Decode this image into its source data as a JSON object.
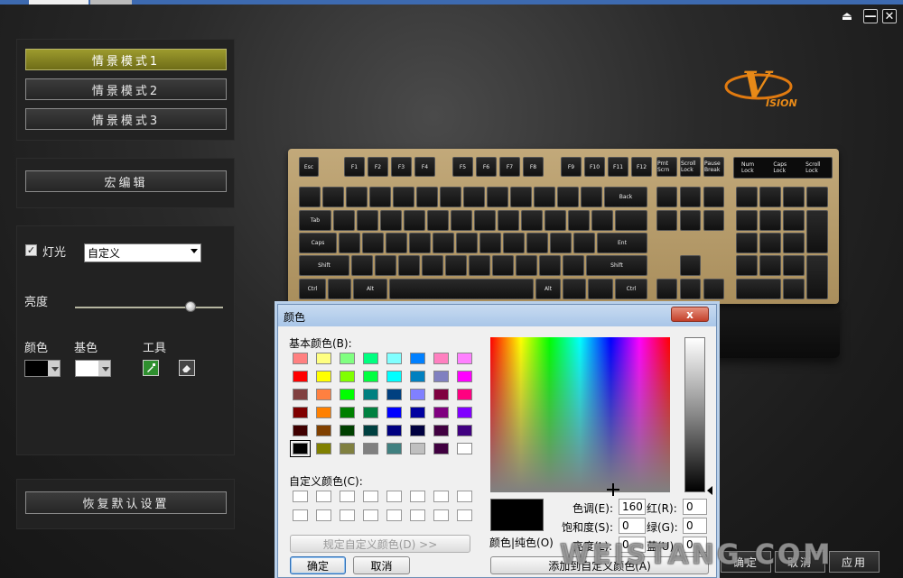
{
  "window": {
    "controls": {
      "eject": "⏏",
      "minimize": "—",
      "close": "✕"
    }
  },
  "left": {
    "modes": [
      {
        "label": "情景模式1",
        "active": true
      },
      {
        "label": "情景模式2",
        "active": false
      },
      {
        "label": "情景模式3",
        "active": false
      }
    ],
    "macro_button": "宏编辑",
    "light": {
      "checkbox_label": "灯光",
      "checked": true,
      "mode_selected": "自定义",
      "brightness_label": "亮度",
      "brightness_level": 0.78,
      "color_label": "颜色",
      "base_color_label": "基色",
      "tool_label": "工具",
      "color_value": "#000000",
      "base_color_value": "#ffffff"
    },
    "restore_button": "恢复默认设置"
  },
  "logo": {
    "text": "ISION",
    "letter": "V",
    "color": "#e07a10"
  },
  "keyboard": {
    "fn_row": [
      "Esc",
      "F1",
      "F2",
      "F3",
      "F4",
      "F5",
      "F6",
      "F7",
      "F8",
      "F9",
      "F10",
      "F11",
      "F12",
      "Prnt Scrn",
      "Scroll Lock",
      "Pause Break"
    ],
    "indicators": [
      "Num Lock",
      "Caps Lock",
      "Scroll Lock"
    ]
  },
  "dialog": {
    "title": "颜色",
    "close": "x",
    "basic_colors_label": "基本颜色(B):",
    "basic_colors": [
      [
        "#ff8080",
        "#ffff80",
        "#80ff80",
        "#00ff80",
        "#80ffff",
        "#0080ff",
        "#ff80c0",
        "#ff80ff"
      ],
      [
        "#ff0000",
        "#ffff00",
        "#80ff00",
        "#00ff40",
        "#00ffff",
        "#0080c0",
        "#8080c0",
        "#ff00ff"
      ],
      [
        "#804040",
        "#ff8040",
        "#00ff00",
        "#008080",
        "#004080",
        "#8080ff",
        "#800040",
        "#ff0080"
      ],
      [
        "#800000",
        "#ff8000",
        "#008000",
        "#008040",
        "#0000ff",
        "#0000a0",
        "#800080",
        "#8000ff"
      ],
      [
        "#400000",
        "#804000",
        "#004000",
        "#004040",
        "#000080",
        "#000040",
        "#400040",
        "#400080"
      ],
      [
        "#000000",
        "#808000",
        "#808040",
        "#808080",
        "#408080",
        "#c0c0c0",
        "#400040",
        "#ffffff"
      ]
    ],
    "selected_basic": [
      5,
      0
    ],
    "custom_colors_label": "自定义颜色(C):",
    "define_custom_button": "规定自定义颜色(D) >>",
    "ok_button": "确定",
    "cancel_button": "取消",
    "add_custom_button": "添加到自定义颜色(A)",
    "preview_label": "颜色|纯色(O)",
    "fields": {
      "hue": {
        "label": "色调(E):",
        "value": "160"
      },
      "sat": {
        "label": "饱和度(S):",
        "value": "0"
      },
      "lum": {
        "label": "亮度(L):",
        "value": "0"
      },
      "red": {
        "label": "红(R):",
        "value": "0"
      },
      "green": {
        "label": "绿(G):",
        "value": "0"
      },
      "blue": {
        "label": "蓝(U):",
        "value": "0"
      }
    }
  },
  "background_buttons": {
    "ok": "确定",
    "cancel": "取消",
    "apply": "应用"
  },
  "watermark": "WEISTANG.COM"
}
